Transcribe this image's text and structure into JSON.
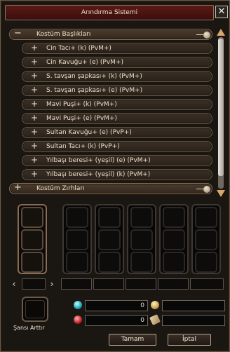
{
  "window": {
    "title": "Arındırma Sistemi",
    "close_label": "✕"
  },
  "list": {
    "rows": [
      {
        "kind": "category",
        "symbol": "−",
        "label": "Kostüm Başlıkları"
      },
      {
        "kind": "item",
        "symbol": "+",
        "label": "Cin Tacı+ (k) (PvM+)"
      },
      {
        "kind": "item",
        "symbol": "+",
        "label": "Cin Kavuğu+ (e) (PvM+)"
      },
      {
        "kind": "item",
        "symbol": "+",
        "label": "S. tavşan şapkası+ (k) (PvM+)"
      },
      {
        "kind": "item",
        "symbol": "+",
        "label": "S. tavşan şapkası+ (e) (PvM+)"
      },
      {
        "kind": "item",
        "symbol": "+",
        "label": "Mavi Puşi+ (k) (PvM+)"
      },
      {
        "kind": "item",
        "symbol": "+",
        "label": "Mavi Puşi+ (e) (PvM+)"
      },
      {
        "kind": "item",
        "symbol": "+",
        "label": "Sultan Kavuğu+ (e) (PvP+)"
      },
      {
        "kind": "item",
        "symbol": "+",
        "label": "Sultan Tacı+ (k) (PvP+)"
      },
      {
        "kind": "item",
        "symbol": "+",
        "label": "Yılbaşı beresi+ (yeşil) (e) (PvM+)"
      },
      {
        "kind": "item",
        "symbol": "+",
        "label": "Yılbaşı beresi+ (yeşil) (k) (PvM+)"
      },
      {
        "kind": "category",
        "symbol": "+",
        "label": "Kostüm Zırhları"
      }
    ]
  },
  "pager": {
    "prev": "‹",
    "next": "›"
  },
  "bottom": {
    "luck_label": "Şansı Arttır",
    "cyan_value": "0",
    "red_value": "0",
    "ok_label": "Tamam",
    "cancel_label": "İptal"
  },
  "icons": [
    "close-icon",
    "minus-icon",
    "plus-icon",
    "scroll-up-icon",
    "scroll-down-icon",
    "cyan-gem-icon",
    "red-gem-icon",
    "gold-coin-icon",
    "scroll-item-icon"
  ]
}
